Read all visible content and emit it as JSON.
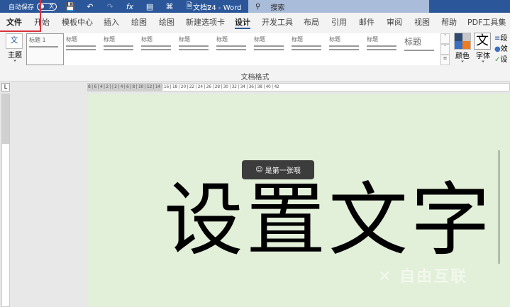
{
  "titlebar": {
    "autosave": "自动保存",
    "toggle": "关",
    "doc_title": "文档24 - Word",
    "search_placeholder": "搜索"
  },
  "tabs": [
    "文件",
    "开始",
    "模板中心",
    "插入",
    "绘图",
    "绘图",
    "新建选项卡",
    "设计",
    "开发工具",
    "布局",
    "引用",
    "邮件",
    "审阅",
    "视图",
    "帮助",
    "PDF工具集"
  ],
  "active_tab": "设计",
  "ribbon": {
    "theme_label": "主题",
    "theme_icon_text": "文",
    "styles": [
      "标题 1",
      "标题",
      "标题",
      "标题",
      "标题",
      "标题",
      "标题",
      "标题",
      "标题",
      "标题",
      "标题"
    ],
    "colors_label": "颜色",
    "fonts_label": "字体",
    "fonts_icon_text": "文",
    "side_items": [
      "段",
      "效",
      "设"
    ],
    "group_label": "文档格式"
  },
  "ruler": "8 | 6 | 4 | 2 |   | 2 | 4 | 6 | 8 | 10 | 12 | 14 | 16 | 18 | 20 | 22 | 24 | 26 | 28 | 30 | 32 | 34 | 36 | 38 | 40 | 42",
  "document": {
    "text": "设置文字"
  },
  "tooltip": {
    "text": "是第一张哦"
  },
  "watermark": "自由互联",
  "colors": {
    "titlebar": "#2b579a",
    "page": "#e2efd9",
    "highlight": "#d9333f"
  }
}
